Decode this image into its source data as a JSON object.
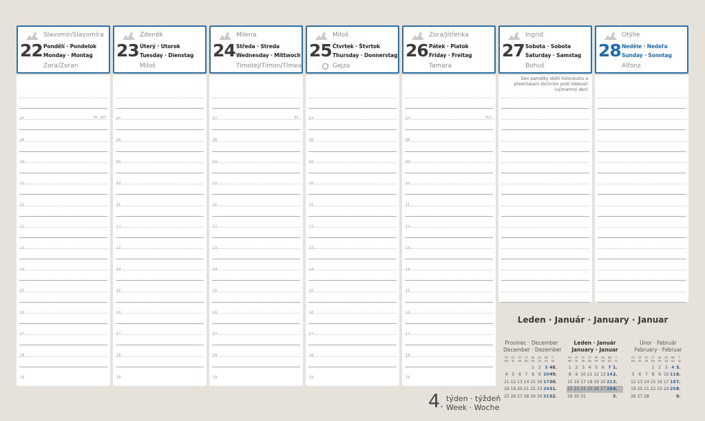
{
  "days": [
    {
      "num": "22",
      "name": "Slavomír/Slavomíra",
      "days_1": "Pondělí · Pondelok",
      "days_2": "Monday · Montag",
      "name2": "Zora/Zoran",
      "sunday": false,
      "moon": false,
      "cap": "NF, UKP",
      "note": ""
    },
    {
      "num": "23",
      "name": "Zdeněk",
      "days_1": "Úterý · Utorok",
      "days_2": "Tuesday · Dienstag",
      "name2": "Miloš",
      "sunday": false,
      "moon": false,
      "cap": "",
      "note": ""
    },
    {
      "num": "24",
      "name": "Milena",
      "days_1": "Středa · Streda",
      "days_2": "Wednesday · Mittwoch",
      "name2": "Timotej/Timon/Tímea",
      "sunday": false,
      "moon": false,
      "cap": "BO",
      "note": ""
    },
    {
      "num": "25",
      "name": "Miloš",
      "days_1": "Čtvrtek · Štvrtok",
      "days_2": "Thursday · Donnerstag",
      "name2": "Gejza",
      "sunday": false,
      "moon": true,
      "cap": "",
      "note": ""
    },
    {
      "num": "26",
      "name": "Zora/Jitřenka",
      "days_1": "Pátek · Piatok",
      "days_2": "Friday · Freitag",
      "name2": "Tamara",
      "sunday": false,
      "moon": false,
      "cap": "AUS",
      "note": ""
    },
    {
      "num": "27",
      "name": "Ingrid",
      "days_1": "Sobota · Sobota",
      "days_2": "Saturday · Samstag",
      "name2": "Bohuš",
      "sunday": false,
      "moon": false,
      "cap": "",
      "note": "Den památky obětí holocaustu a předcházení zločinům proti lidskosti (významný den)"
    },
    {
      "num": "28",
      "name": "Otýlie",
      "days_1": "Neděle · Nedeľa",
      "days_2": "Sunday · Sonntag",
      "name2": "Alfonz",
      "sunday": true,
      "moon": false,
      "cap": "",
      "note": ""
    }
  ],
  "hours": [
    "07",
    "08",
    "09",
    "10",
    "11",
    "12",
    "13",
    "14",
    "15",
    "16",
    "17",
    "18",
    "19"
  ],
  "month_title": "Leden · Január · January · Januar",
  "weekday_heads": [
    [
      "PO",
      "MO"
    ],
    [
      "ÚT",
      "DI"
    ],
    [
      "ST",
      "MI"
    ],
    [
      "ČT",
      "DO"
    ],
    [
      "PÁ",
      "FR"
    ],
    [
      "SO",
      "SA"
    ],
    [
      "NE",
      "SO"
    ],
    [
      "T",
      "W"
    ]
  ],
  "calendars": [
    {
      "title1": "Prosinec · December",
      "title2": "December · Dezember",
      "current": false,
      "weeks": [
        [
          "",
          "",
          "",
          "",
          "",
          "",
          "",
          ""
        ],
        [
          "",
          "",
          "",
          "",
          "1",
          "2",
          "3",
          "48."
        ],
        [
          "4",
          "5",
          "6",
          "7",
          "8",
          "9",
          "10",
          "49."
        ],
        [
          "11",
          "12",
          "13",
          "14",
          "15",
          "16",
          "17",
          "50."
        ],
        [
          "18",
          "19",
          "20",
          "21",
          "22",
          "23",
          "24",
          "51."
        ],
        [
          "25",
          "26",
          "27",
          "28",
          "29",
          "30",
          "31",
          "52."
        ]
      ]
    },
    {
      "title1": "Leden · Január",
      "title2": "January · Januar",
      "current": true,
      "weeks": [
        [
          "",
          "",
          "",
          "",
          "",
          "",
          "",
          ""
        ],
        [
          "1",
          "2",
          "3",
          "4",
          "5",
          "6",
          "7",
          "1."
        ],
        [
          "8",
          "9",
          "10",
          "11",
          "12",
          "13",
          "14",
          "2."
        ],
        [
          "15",
          "16",
          "17",
          "18",
          "19",
          "20",
          "21",
          "3."
        ],
        [
          "22",
          "23",
          "24",
          "25",
          "26",
          "27",
          "28",
          "4."
        ],
        [
          "29",
          "30",
          "31",
          "",
          "",
          "",
          "",
          "5."
        ]
      ]
    },
    {
      "title1": "Únor · Február",
      "title2": "February · Februar",
      "current": false,
      "weeks": [
        [
          "",
          "",
          "",
          "",
          "",
          "",
          "",
          ""
        ],
        [
          "",
          "",
          "",
          "1",
          "2",
          "3",
          "4",
          "5."
        ],
        [
          "5",
          "6",
          "7",
          "8",
          "9",
          "10",
          "11",
          "6."
        ],
        [
          "12",
          "13",
          "14",
          "15",
          "16",
          "17",
          "18",
          "7."
        ],
        [
          "19",
          "20",
          "21",
          "22",
          "23",
          "24",
          "25",
          "8."
        ],
        [
          "26",
          "27",
          "28",
          "",
          "",
          "",
          "",
          "9."
        ]
      ]
    }
  ],
  "current_week_row": 4,
  "week_number": "4",
  "week_label_1": "týden · týždeň",
  "week_label_2": "Week · Woche",
  "colors": {
    "accent": "#2c6fa5",
    "sunday": "#1f6ab0"
  }
}
